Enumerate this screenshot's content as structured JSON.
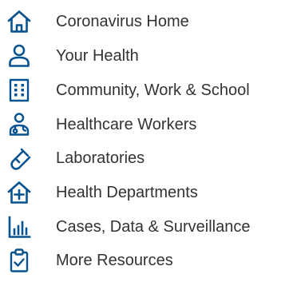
{
  "accent_color": "#075290",
  "text_color": "#333333",
  "menu": {
    "items": [
      {
        "label": "Coronavirus Home",
        "icon": "house-icon"
      },
      {
        "label": "Your Health",
        "icon": "person-icon"
      },
      {
        "label": "Community, Work & School",
        "icon": "building-icon"
      },
      {
        "label": "Healthcare Workers",
        "icon": "healthcare-worker-icon"
      },
      {
        "label": "Laboratories",
        "icon": "test-tube-icon"
      },
      {
        "label": "Health Departments",
        "icon": "health-department-icon"
      },
      {
        "label": "Cases, Data & Surveillance",
        "icon": "bar-chart-icon"
      },
      {
        "label": "More Resources",
        "icon": "clipboard-check-icon"
      }
    ]
  }
}
